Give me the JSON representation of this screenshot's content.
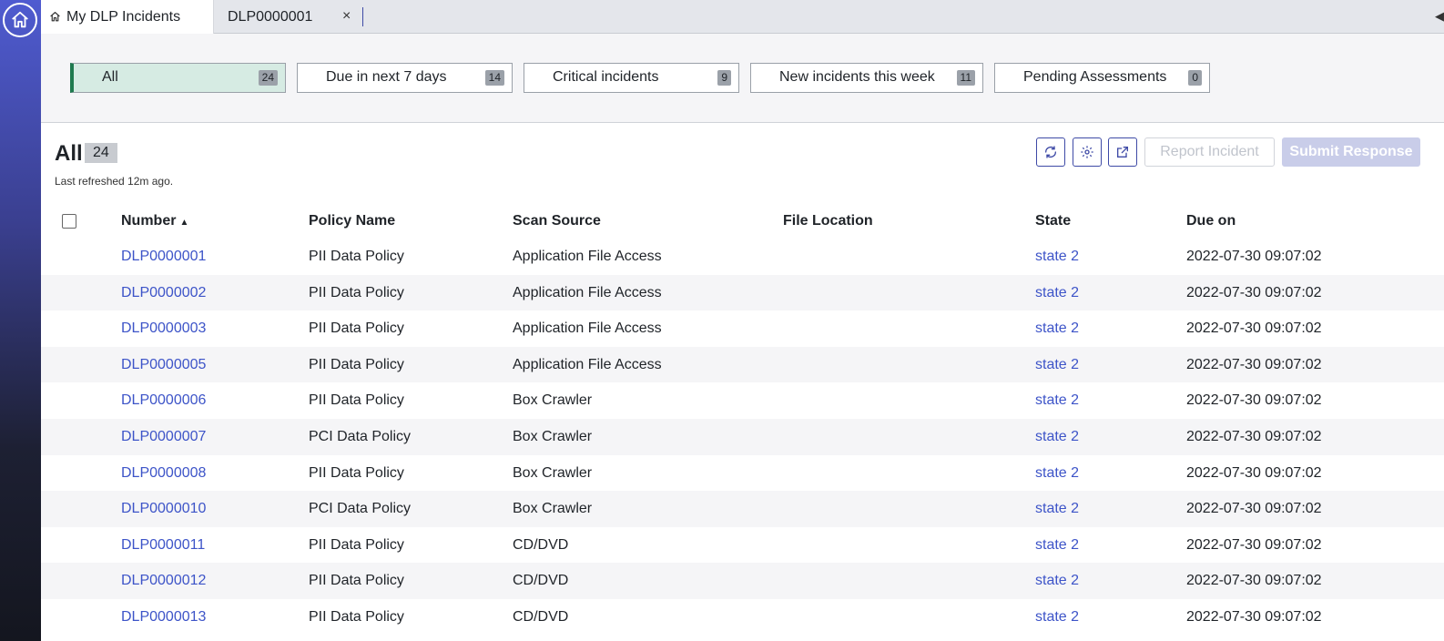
{
  "tabs": {
    "active_label": "My DLP Incidents",
    "second_label": "DLP0000001",
    "close_glyph": "×"
  },
  "filters": [
    {
      "label": "All",
      "count": "24"
    },
    {
      "label": "Due in next 7 days",
      "count": "14"
    },
    {
      "label": "Critical incidents",
      "count": "9"
    },
    {
      "label": "New incidents this week",
      "count": "11"
    },
    {
      "label": "Pending Assessments",
      "count": "0"
    }
  ],
  "list": {
    "title": "All",
    "count": "24",
    "refreshed": "Last refreshed 12m ago."
  },
  "toolbar": {
    "refresh_icon": "refresh-icon",
    "settings_icon": "gear-icon",
    "export_icon": "export-icon",
    "report_label": "Report Incident",
    "submit_label": "Submit Response"
  },
  "table": {
    "columns": [
      "Number",
      "Policy Name",
      "Scan Source",
      "File Location",
      "State",
      "Due on"
    ],
    "sort_glyph": "▲",
    "rows": [
      {
        "number": "DLP0000001",
        "policy": "PII Data Policy",
        "source": "Application File Access",
        "location": "",
        "state": "state 2",
        "due": "2022-07-30 09:07:02"
      },
      {
        "number": "DLP0000002",
        "policy": "PII Data Policy",
        "source": "Application File Access",
        "location": "",
        "state": "state 2",
        "due": "2022-07-30 09:07:02"
      },
      {
        "number": "DLP0000003",
        "policy": "PII Data Policy",
        "source": "Application File Access",
        "location": "",
        "state": "state 2",
        "due": "2022-07-30 09:07:02"
      },
      {
        "number": "DLP0000005",
        "policy": "PII Data Policy",
        "source": "Application File Access",
        "location": "",
        "state": "state 2",
        "due": "2022-07-30 09:07:02"
      },
      {
        "number": "DLP0000006",
        "policy": "PII Data Policy",
        "source": "Box Crawler",
        "location": "",
        "state": "state 2",
        "due": "2022-07-30 09:07:02"
      },
      {
        "number": "DLP0000007",
        "policy": "PCI Data Policy",
        "source": "Box Crawler",
        "location": "",
        "state": "state 2",
        "due": "2022-07-30 09:07:02"
      },
      {
        "number": "DLP0000008",
        "policy": "PII Data Policy",
        "source": "Box Crawler",
        "location": "",
        "state": "state 2",
        "due": "2022-07-30 09:07:02"
      },
      {
        "number": "DLP0000010",
        "policy": "PCI Data Policy",
        "source": "Box Crawler",
        "location": "",
        "state": "state 2",
        "due": "2022-07-30 09:07:02"
      },
      {
        "number": "DLP0000011",
        "policy": "PII Data Policy",
        "source": "CD/DVD",
        "location": "",
        "state": "state 2",
        "due": "2022-07-30 09:07:02"
      },
      {
        "number": "DLP0000012",
        "policy": "PII Data Policy",
        "source": "CD/DVD",
        "location": "",
        "state": "state 2",
        "due": "2022-07-30 09:07:02"
      },
      {
        "number": "DLP0000013",
        "policy": "PII Data Policy",
        "source": "CD/DVD",
        "location": "",
        "state": "state 2",
        "due": "2022-07-30 09:07:02"
      }
    ]
  },
  "colors": {
    "accent": "#3d54c8",
    "selected_filter_bg": "#d6ebe3",
    "selected_filter_border": "#1f7a4f"
  }
}
